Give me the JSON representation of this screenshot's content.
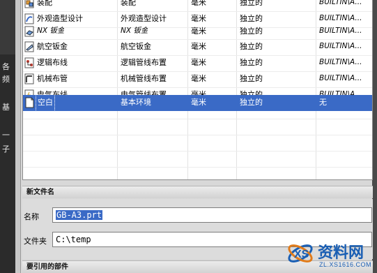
{
  "left_strip": {
    "glyphs": [
      "各",
      "频",
      "基",
      "一",
      "子"
    ]
  },
  "templates": {
    "rows": [
      {
        "name": "装配",
        "type": "装配",
        "unit": "毫米",
        "relation": "独立的",
        "owner": "BUILTIN\\A...",
        "icon": "assembly-icon",
        "selected": false
      },
      {
        "name": "外观造型设计",
        "type": "外观造型设计",
        "unit": "毫米",
        "relation": "独立的",
        "owner": "BUILTIN\\A...",
        "icon": "shape-studio-icon",
        "selected": false
      },
      {
        "name": "NX 钣金",
        "type": "NX 钣金",
        "unit": "毫米",
        "relation": "独立的",
        "owner": "BUILTIN\\A...",
        "icon": "sheet-metal-icon",
        "selected": false
      },
      {
        "name": "航空钣金",
        "type": "航空钣金",
        "unit": "毫米",
        "relation": "独立的",
        "owner": "BUILTIN\\A...",
        "icon": "aero-sheet-metal-icon",
        "selected": false
      },
      {
        "name": "逻辑布线",
        "type": "逻辑管线布置",
        "unit": "毫米",
        "relation": "独立的",
        "owner": "BUILTIN\\A...",
        "icon": "logical-routing-icon",
        "selected": false
      },
      {
        "name": "机械布管",
        "type": "机械管线布置",
        "unit": "毫米",
        "relation": "独立的",
        "owner": "BUILTIN\\A...",
        "icon": "mechanical-routing-icon",
        "selected": false
      },
      {
        "name": "电气布线",
        "type": "电气管线布置",
        "unit": "毫米",
        "relation": "独立的",
        "owner": "BUILTIN\\A...",
        "icon": "electrical-routing-icon",
        "selected": false
      },
      {
        "name": "空白",
        "type": "基本环境",
        "unit": "毫米",
        "relation": "独立的",
        "owner": "无",
        "icon": "blank-icon",
        "selected": true
      }
    ]
  },
  "new_file": {
    "section_title": "新文件名",
    "name_label": "名称",
    "name_value": "GB-A3.prt",
    "folder_label": "文件夹",
    "folder_value": "C:\\temp"
  },
  "referenced_section_title": "要引用的部件",
  "watermark": {
    "text": "资料网",
    "url": "ZL.XS1616.COM",
    "accent": "#1a5fb4"
  },
  "colors": {
    "selection": "#3a6ac6"
  }
}
